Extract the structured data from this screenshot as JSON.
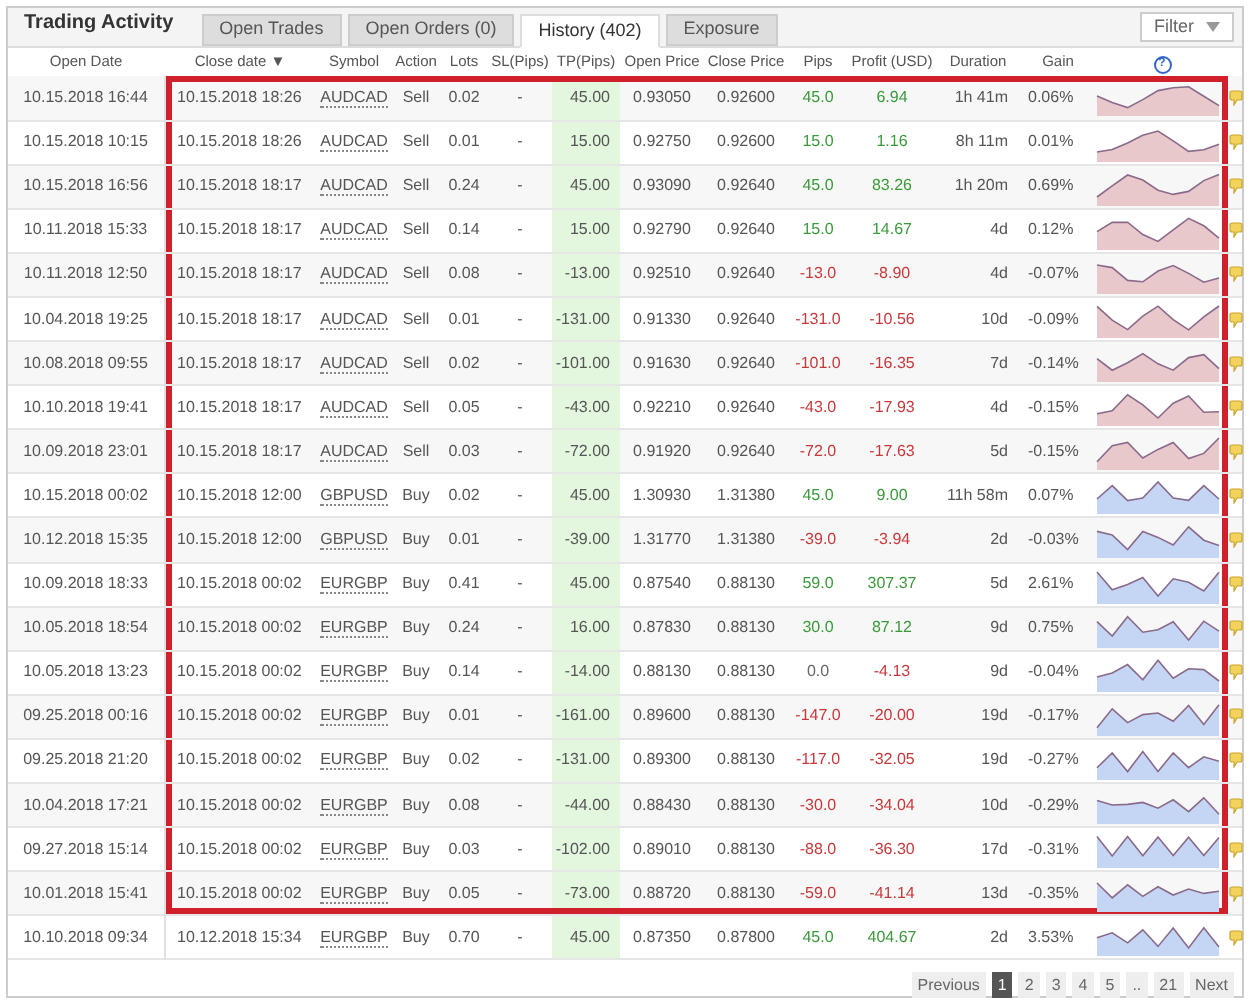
{
  "title": "Trading Activity",
  "tabs": [
    {
      "label": "Open Trades",
      "selected": false
    },
    {
      "label": "Open Orders (0)",
      "selected": false
    },
    {
      "label": "History (402)",
      "selected": true
    },
    {
      "label": "Exposure",
      "selected": false
    }
  ],
  "filter": {
    "label": "Filter"
  },
  "columns": [
    "Open Date",
    "Close date",
    "Symbol",
    "Action",
    "Lots",
    "SL(Pips)",
    "TP(Pips)",
    "Open Price",
    "Close Price",
    "Pips",
    "Profit (USD)",
    "Duration",
    "Gain"
  ],
  "sort_indicator": "▼",
  "help": "?",
  "rows": [
    {
      "open_date": "10.15.2018 16:44",
      "close_date": "10.15.2018 18:26",
      "symbol": "AUDCAD",
      "action": "Sell",
      "lots": "0.02",
      "sl": "-",
      "tp": "45.00",
      "open_price": "0.93050",
      "close_price": "0.92600",
      "pips": "45.0",
      "profit": "6.94",
      "duration": "1h 41m",
      "gain": "0.06%",
      "color": "#e8c8cb",
      "highlighted": true
    },
    {
      "open_date": "10.15.2018 10:15",
      "close_date": "10.15.2018 18:26",
      "symbol": "AUDCAD",
      "action": "Sell",
      "lots": "0.01",
      "sl": "-",
      "tp": "15.00",
      "open_price": "0.92750",
      "close_price": "0.92600",
      "pips": "15.0",
      "profit": "1.16",
      "duration": "8h 11m",
      "gain": "0.01%",
      "color": "#e8c8cb",
      "highlighted": true
    },
    {
      "open_date": "10.15.2018 16:56",
      "close_date": "10.15.2018 18:17",
      "symbol": "AUDCAD",
      "action": "Sell",
      "lots": "0.24",
      "sl": "-",
      "tp": "45.00",
      "open_price": "0.93090",
      "close_price": "0.92640",
      "pips": "45.0",
      "profit": "83.26",
      "duration": "1h 20m",
      "gain": "0.69%",
      "color": "#e8c8cb",
      "highlighted": true
    },
    {
      "open_date": "10.11.2018 15:33",
      "close_date": "10.15.2018 18:17",
      "symbol": "AUDCAD",
      "action": "Sell",
      "lots": "0.14",
      "sl": "-",
      "tp": "15.00",
      "open_price": "0.92790",
      "close_price": "0.92640",
      "pips": "15.0",
      "profit": "14.67",
      "duration": "4d",
      "gain": "0.12%",
      "color": "#e8c8cb",
      "highlighted": true
    },
    {
      "open_date": "10.11.2018 12:50",
      "close_date": "10.15.2018 18:17",
      "symbol": "AUDCAD",
      "action": "Sell",
      "lots": "0.08",
      "sl": "-",
      "tp": "-13.00",
      "open_price": "0.92510",
      "close_price": "0.92640",
      "pips": "-13.0",
      "profit": "-8.90",
      "duration": "4d",
      "gain": "-0.07%",
      "color": "#e8c8cb",
      "highlighted": true
    },
    {
      "open_date": "10.04.2018 19:25",
      "close_date": "10.15.2018 18:17",
      "symbol": "AUDCAD",
      "action": "Sell",
      "lots": "0.01",
      "sl": "-",
      "tp": "-131.00",
      "open_price": "0.91330",
      "close_price": "0.92640",
      "pips": "-131.0",
      "profit": "-10.56",
      "duration": "10d",
      "gain": "-0.09%",
      "color": "#e8c8cb",
      "highlighted": true
    },
    {
      "open_date": "10.08.2018 09:55",
      "close_date": "10.15.2018 18:17",
      "symbol": "AUDCAD",
      "action": "Sell",
      "lots": "0.02",
      "sl": "-",
      "tp": "-101.00",
      "open_price": "0.91630",
      "close_price": "0.92640",
      "pips": "-101.0",
      "profit": "-16.35",
      "duration": "7d",
      "gain": "-0.14%",
      "color": "#e8c8cb",
      "highlighted": true
    },
    {
      "open_date": "10.10.2018 19:41",
      "close_date": "10.15.2018 18:17",
      "symbol": "AUDCAD",
      "action": "Sell",
      "lots": "0.05",
      "sl": "-",
      "tp": "-43.00",
      "open_price": "0.92210",
      "close_price": "0.92640",
      "pips": "-43.0",
      "profit": "-17.93",
      "duration": "4d",
      "gain": "-0.15%",
      "color": "#e8c8cb",
      "highlighted": true
    },
    {
      "open_date": "10.09.2018 23:01",
      "close_date": "10.15.2018 18:17",
      "symbol": "AUDCAD",
      "action": "Sell",
      "lots": "0.03",
      "sl": "-",
      "tp": "-72.00",
      "open_price": "0.91920",
      "close_price": "0.92640",
      "pips": "-72.0",
      "profit": "-17.63",
      "duration": "5d",
      "gain": "-0.15%",
      "color": "#e8c8cb",
      "highlighted": true
    },
    {
      "open_date": "10.15.2018 00:02",
      "close_date": "10.15.2018 12:00",
      "symbol": "GBPUSD",
      "action": "Buy",
      "lots": "0.02",
      "sl": "-",
      "tp": "45.00",
      "open_price": "1.30930",
      "close_price": "1.31380",
      "pips": "45.0",
      "profit": "9.00",
      "duration": "11h 58m",
      "gain": "0.07%",
      "color": "#c5d6f5",
      "highlighted": true
    },
    {
      "open_date": "10.12.2018 15:35",
      "close_date": "10.15.2018 12:00",
      "symbol": "GBPUSD",
      "action": "Buy",
      "lots": "0.01",
      "sl": "-",
      "tp": "-39.00",
      "open_price": "1.31770",
      "close_price": "1.31380",
      "pips": "-39.0",
      "profit": "-3.94",
      "duration": "2d",
      "gain": "-0.03%",
      "color": "#c5d6f5",
      "highlighted": true
    },
    {
      "open_date": "10.09.2018 18:33",
      "close_date": "10.15.2018 00:02",
      "symbol": "EURGBP",
      "action": "Buy",
      "lots": "0.41",
      "sl": "-",
      "tp": "45.00",
      "open_price": "0.87540",
      "close_price": "0.88130",
      "pips": "59.0",
      "profit": "307.37",
      "duration": "5d",
      "gain": "2.61%",
      "color": "#c5d6f5",
      "highlighted": true
    },
    {
      "open_date": "10.05.2018 18:54",
      "close_date": "10.15.2018 00:02",
      "symbol": "EURGBP",
      "action": "Buy",
      "lots": "0.24",
      "sl": "-",
      "tp": "16.00",
      "open_price": "0.87830",
      "close_price": "0.88130",
      "pips": "30.0",
      "profit": "87.12",
      "duration": "9d",
      "gain": "0.75%",
      "color": "#c5d6f5",
      "highlighted": true
    },
    {
      "open_date": "10.05.2018 13:23",
      "close_date": "10.15.2018 00:02",
      "symbol": "EURGBP",
      "action": "Buy",
      "lots": "0.14",
      "sl": "-",
      "tp": "-14.00",
      "open_price": "0.88130",
      "close_price": "0.88130",
      "pips": "0.0",
      "profit": "-4.13",
      "duration": "9d",
      "gain": "-0.04%",
      "color": "#c5d6f5",
      "highlighted": true
    },
    {
      "open_date": "09.25.2018 00:16",
      "close_date": "10.15.2018 00:02",
      "symbol": "EURGBP",
      "action": "Buy",
      "lots": "0.01",
      "sl": "-",
      "tp": "-161.00",
      "open_price": "0.89600",
      "close_price": "0.88130",
      "pips": "-147.0",
      "profit": "-20.00",
      "duration": "19d",
      "gain": "-0.17%",
      "color": "#c5d6f5",
      "highlighted": true
    },
    {
      "open_date": "09.25.2018 21:20",
      "close_date": "10.15.2018 00:02",
      "symbol": "EURGBP",
      "action": "Buy",
      "lots": "0.02",
      "sl": "-",
      "tp": "-131.00",
      "open_price": "0.89300",
      "close_price": "0.88130",
      "pips": "-117.0",
      "profit": "-32.05",
      "duration": "19d",
      "gain": "-0.27%",
      "color": "#c5d6f5",
      "highlighted": true
    },
    {
      "open_date": "10.04.2018 17:21",
      "close_date": "10.15.2018 00:02",
      "symbol": "EURGBP",
      "action": "Buy",
      "lots": "0.08",
      "sl": "-",
      "tp": "-44.00",
      "open_price": "0.88430",
      "close_price": "0.88130",
      "pips": "-30.0",
      "profit": "-34.04",
      "duration": "10d",
      "gain": "-0.29%",
      "color": "#c5d6f5",
      "highlighted": true
    },
    {
      "open_date": "09.27.2018 15:14",
      "close_date": "10.15.2018 00:02",
      "symbol": "EURGBP",
      "action": "Buy",
      "lots": "0.03",
      "sl": "-",
      "tp": "-102.00",
      "open_price": "0.89010",
      "close_price": "0.88130",
      "pips": "-88.0",
      "profit": "-36.30",
      "duration": "17d",
      "gain": "-0.31%",
      "color": "#c5d6f5",
      "highlighted": true
    },
    {
      "open_date": "10.01.2018 15:41",
      "close_date": "10.15.2018 00:02",
      "symbol": "EURGBP",
      "action": "Buy",
      "lots": "0.05",
      "sl": "-",
      "tp": "-73.00",
      "open_price": "0.88720",
      "close_price": "0.88130",
      "pips": "-59.0",
      "profit": "-41.14",
      "duration": "13d",
      "gain": "-0.35%",
      "color": "#c5d6f5",
      "highlighted": true
    },
    {
      "open_date": "10.10.2018 09:34",
      "close_date": "10.12.2018 15:34",
      "symbol": "EURGBP",
      "action": "Buy",
      "lots": "0.70",
      "sl": "-",
      "tp": "45.00",
      "open_price": "0.87350",
      "close_price": "0.87800",
      "pips": "45.0",
      "profit": "404.67",
      "duration": "2d",
      "gain": "3.53%",
      "color": "#c5d6f5",
      "highlighted": false
    }
  ],
  "pagination": [
    {
      "label": "Previous",
      "selected": false
    },
    {
      "label": "1",
      "selected": true
    },
    {
      "label": "2",
      "selected": false
    },
    {
      "label": "3",
      "selected": false
    },
    {
      "label": "4",
      "selected": false
    },
    {
      "label": "5",
      "selected": false
    },
    {
      "label": "..",
      "selected": false
    },
    {
      "label": "21",
      "selected": false
    },
    {
      "label": "Next",
      "selected": false
    }
  ]
}
